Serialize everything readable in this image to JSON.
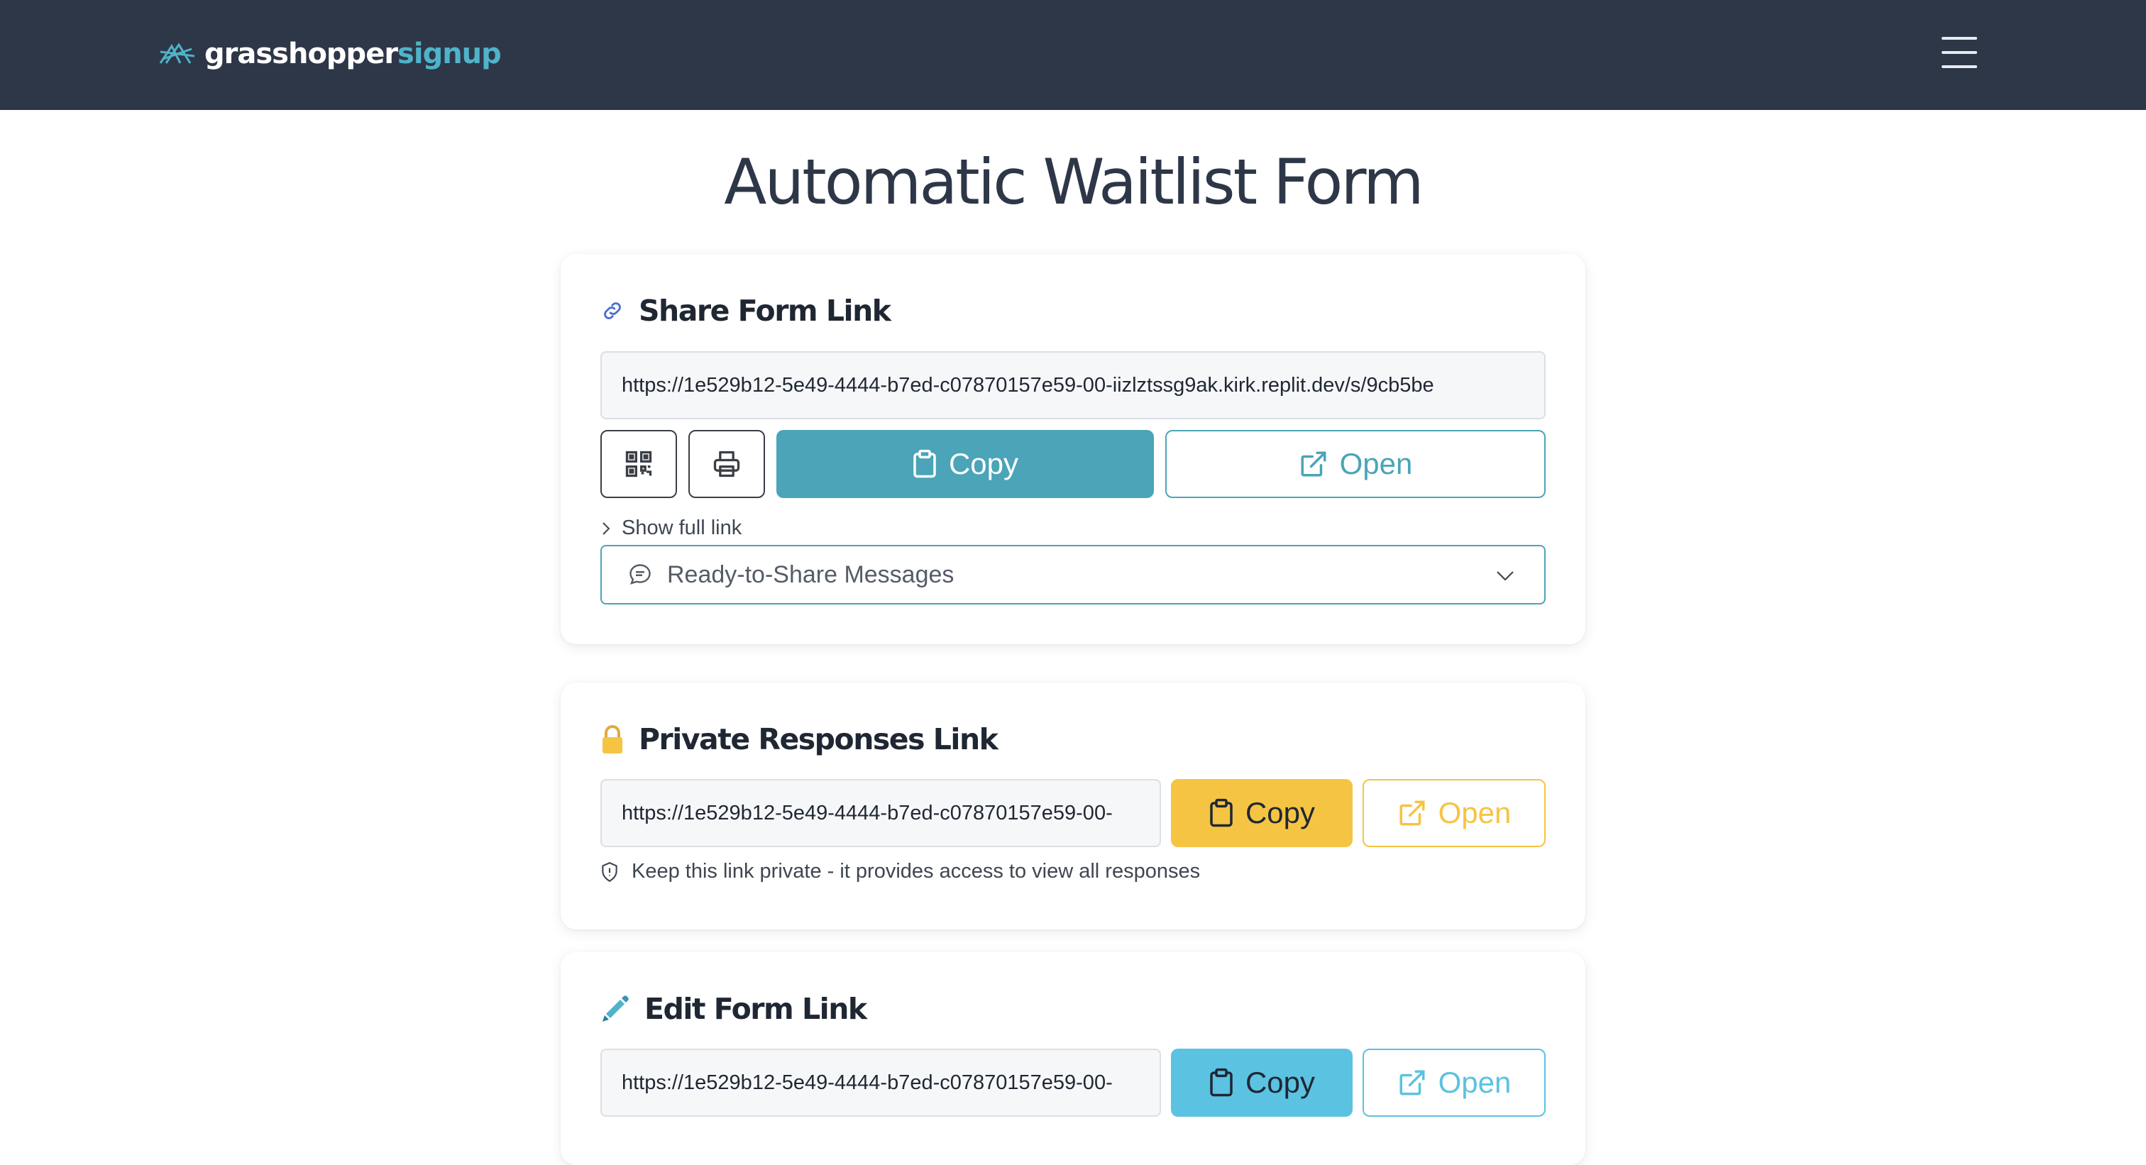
{
  "app": {
    "brand_primary": "grasshopper",
    "brand_secondary": "signup",
    "colors": {
      "header_bg": "#2e3748",
      "brand_accent": "#4fb3c9",
      "teal": "#4ba4b8",
      "yellow": "#f6c443",
      "blue": "#5bc2e2"
    }
  },
  "header": {
    "menu_icon": "hamburger-menu-icon"
  },
  "page": {
    "title": "Automatic Waitlist Form"
  },
  "share_card": {
    "title": "Share Form Link",
    "icon": "link-icon",
    "url": "https://1e529b12-5e49-4444-b7ed-c07870157e59-00-iizlztssg9ak.kirk.replit.dev/s/9cb5be",
    "qr_icon": "qr-code-icon",
    "print_icon": "printer-icon",
    "copy_label": "Copy",
    "open_label": "Open",
    "show_full_link": "Show full link",
    "messages_label": "Ready-to-Share Messages"
  },
  "private_card": {
    "title": "Private Responses Link",
    "icon": "lock-icon",
    "url": "https://1e529b12-5e49-4444-b7ed-c07870157e59-00-",
    "copy_label": "Copy",
    "open_label": "Open",
    "note": "Keep this link private - it provides access to view all responses"
  },
  "edit_card": {
    "title": "Edit Form Link",
    "icon": "pencil-icon",
    "url": "https://1e529b12-5e49-4444-b7ed-c07870157e59-00-",
    "copy_label": "Copy",
    "open_label": "Open"
  }
}
